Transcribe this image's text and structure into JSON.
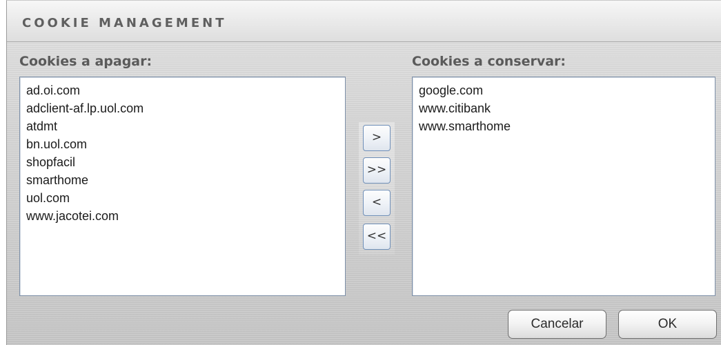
{
  "dialog": {
    "title": "COOKIE MANAGEMENT"
  },
  "left_list": {
    "label": "Cookies a apagar:",
    "items": [
      "ad.oi.com",
      "adclient-af.lp.uol.com",
      "atdmt",
      "bn.uol.com",
      "shopfacil",
      "smarthome",
      "uol.com",
      "www.jacotei.com"
    ]
  },
  "right_list": {
    "label": "Cookies a conservar:",
    "items": [
      "google.com",
      "www.citibank",
      "www.smarthome"
    ]
  },
  "move_buttons": {
    "move_one_right": ">",
    "move_all_right": ">>",
    "move_one_left": "<",
    "move_all_left": "<<"
  },
  "footer": {
    "cancel_label": "Cancelar",
    "ok_label": "OK"
  }
}
